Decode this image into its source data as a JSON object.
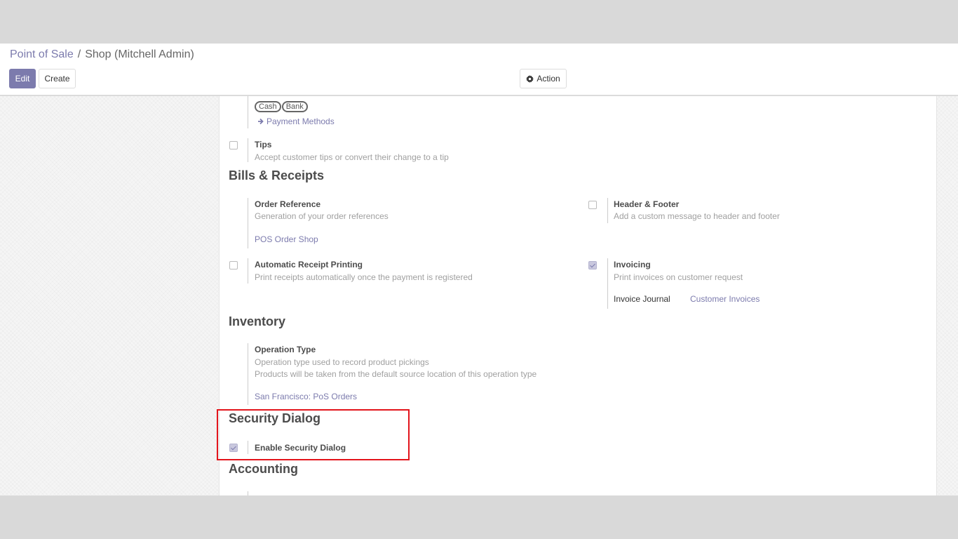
{
  "breadcrumb": {
    "root": "Point of Sale",
    "separator": "/",
    "current": "Shop (Mitchell Admin)"
  },
  "toolbar": {
    "edit_label": "Edit",
    "create_label": "Create",
    "action_label": "Action"
  },
  "payments": {
    "tags": [
      "Cash",
      "Bank"
    ],
    "link_label": "Payment Methods"
  },
  "tips": {
    "title": "Tips",
    "description": "Accept customer tips or convert their change to a tip",
    "checked": false
  },
  "bills": {
    "heading": "Bills & Receipts",
    "order_reference": {
      "title": "Order Reference",
      "description": "Generation of your order references",
      "link": "POS Order Shop"
    },
    "header_footer": {
      "title": "Header & Footer",
      "description": "Add a custom message to header and footer",
      "checked": false
    },
    "auto_receipt": {
      "title": "Automatic Receipt Printing",
      "description": "Print receipts automatically once the payment is registered",
      "checked": false
    },
    "invoicing": {
      "title": "Invoicing",
      "description": "Print invoices on customer request",
      "checked": true,
      "journal_label": "Invoice Journal",
      "journal_value": "Customer Invoices"
    }
  },
  "inventory": {
    "heading": "Inventory",
    "operation_type": {
      "title": "Operation Type",
      "description_1": "Operation type used to record product pickings",
      "description_2": "Products will be taken from the default source location of this operation type",
      "link": "San Francisco: PoS Orders"
    }
  },
  "security": {
    "heading": "Security Dialog",
    "option_title": "Enable Security Dialog",
    "checked": true
  },
  "accounting": {
    "heading": "Accounting"
  },
  "colors": {
    "accent": "#7c7bad",
    "highlight": "#e3141b"
  }
}
